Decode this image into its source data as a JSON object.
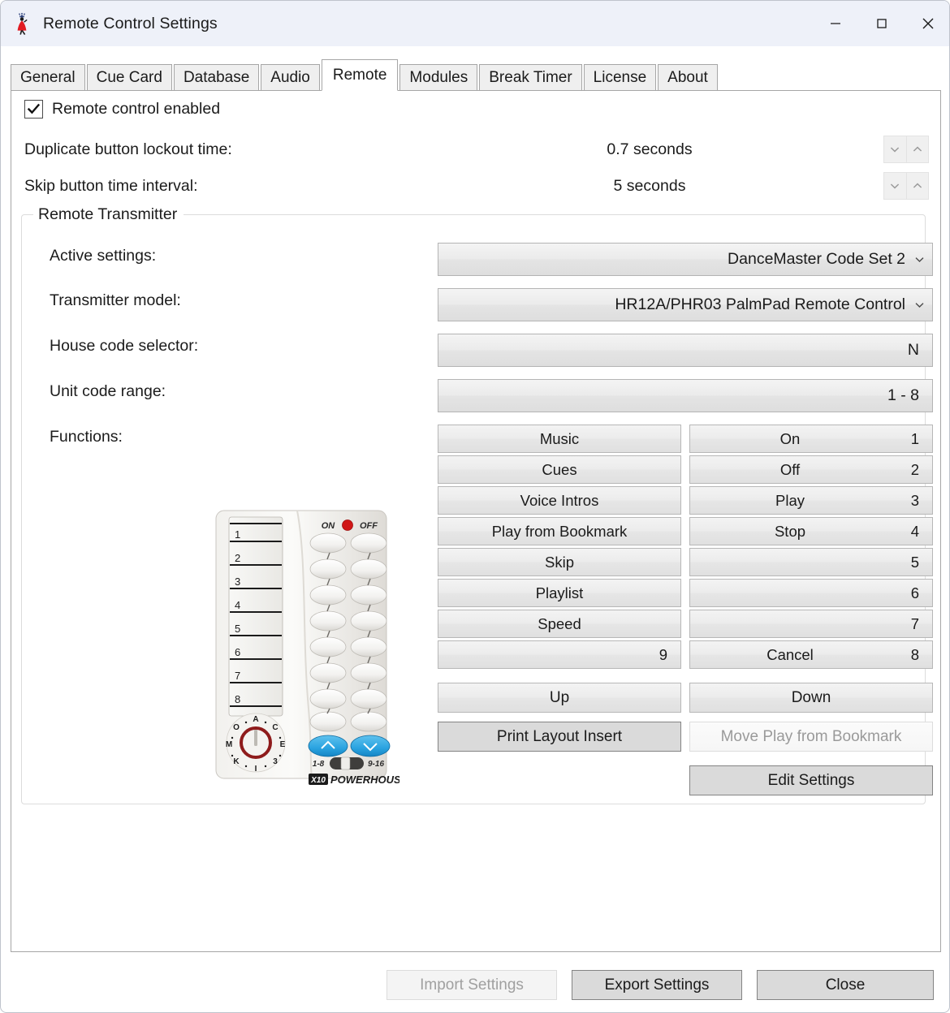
{
  "window": {
    "title": "Remote Control Settings",
    "icon": "dancer-app-icon",
    "controls": {
      "minimize": "minimize-icon",
      "maximize": "maximize-icon",
      "close": "close-icon"
    }
  },
  "tabs": [
    {
      "label": "General",
      "active": false
    },
    {
      "label": "Cue Card",
      "active": false
    },
    {
      "label": "Database",
      "active": false
    },
    {
      "label": "Audio",
      "active": false
    },
    {
      "label": "Remote",
      "active": true
    },
    {
      "label": "Modules",
      "active": false
    },
    {
      "label": "Break Timer",
      "active": false
    },
    {
      "label": "License",
      "active": false
    },
    {
      "label": "About",
      "active": false
    }
  ],
  "remote_enabled": {
    "label": "Remote control enabled",
    "checked": true,
    "check_glyph": "✔"
  },
  "spin_rows": [
    {
      "label": "Duplicate button lockout time:",
      "value": "0.7 seconds"
    },
    {
      "label": "Skip button time interval:",
      "value": "5 seconds"
    }
  ],
  "group": {
    "title": "Remote Transmitter",
    "fields": [
      {
        "label": "Active settings:",
        "value": "DanceMaster Code Set 2",
        "type": "combo"
      },
      {
        "label": "Transmitter model:",
        "value": "HR12A/PHR03 PalmPad Remote Control",
        "type": "combo"
      },
      {
        "label": "House code selector:",
        "value": "N",
        "type": "readonly"
      },
      {
        "label": "Unit code range:",
        "value": "1 - 8",
        "type": "readonly"
      }
    ],
    "functions_label": "Functions:",
    "functions_left": [
      {
        "label": "Music",
        "num": ""
      },
      {
        "label": "Cues",
        "num": ""
      },
      {
        "label": "Voice Intros",
        "num": ""
      },
      {
        "label": "Play from Bookmark",
        "num": ""
      },
      {
        "label": "Skip",
        "num": ""
      },
      {
        "label": "Playlist",
        "num": ""
      },
      {
        "label": "Speed",
        "num": ""
      },
      {
        "label": "9",
        "num": ""
      }
    ],
    "functions_right": [
      {
        "label": "On",
        "num": "1"
      },
      {
        "label": "Off",
        "num": "2"
      },
      {
        "label": "Play",
        "num": "3"
      },
      {
        "label": "Stop",
        "num": "4"
      },
      {
        "label": "",
        "num": "5"
      },
      {
        "label": "",
        "num": "6"
      },
      {
        "label": "",
        "num": "7"
      },
      {
        "label": "Cancel",
        "num": "8"
      }
    ],
    "actions": {
      "up": "Up",
      "down": "Down",
      "print_layout_insert": "Print Layout Insert",
      "move_play_from_bookmark": "Move Play from Bookmark",
      "edit_settings": "Edit Settings"
    }
  },
  "remote_device": {
    "brand": "POWERHOUSE",
    "brand_mark": "X10",
    "on_label": "ON",
    "off_label": "OFF",
    "unit_numbers": [
      "1",
      "2",
      "3",
      "4",
      "5",
      "6",
      "7",
      "8"
    ],
    "dial_letters": [
      "A",
      "C",
      "E",
      "3",
      "I",
      "K",
      "M",
      "O"
    ],
    "range_left": "1-8",
    "range_right": "9-16"
  },
  "footer": {
    "import": {
      "label": "Import Settings",
      "disabled": true
    },
    "export": {
      "label": "Export Settings",
      "disabled": false
    },
    "close": {
      "label": "Close",
      "disabled": false
    }
  },
  "colors": {
    "titlebar": "#eef1f9",
    "accent_red": "#e11b22",
    "panel": "#ffffff",
    "button_face": "#dadada",
    "disabled_text": "#a0a0a0"
  }
}
